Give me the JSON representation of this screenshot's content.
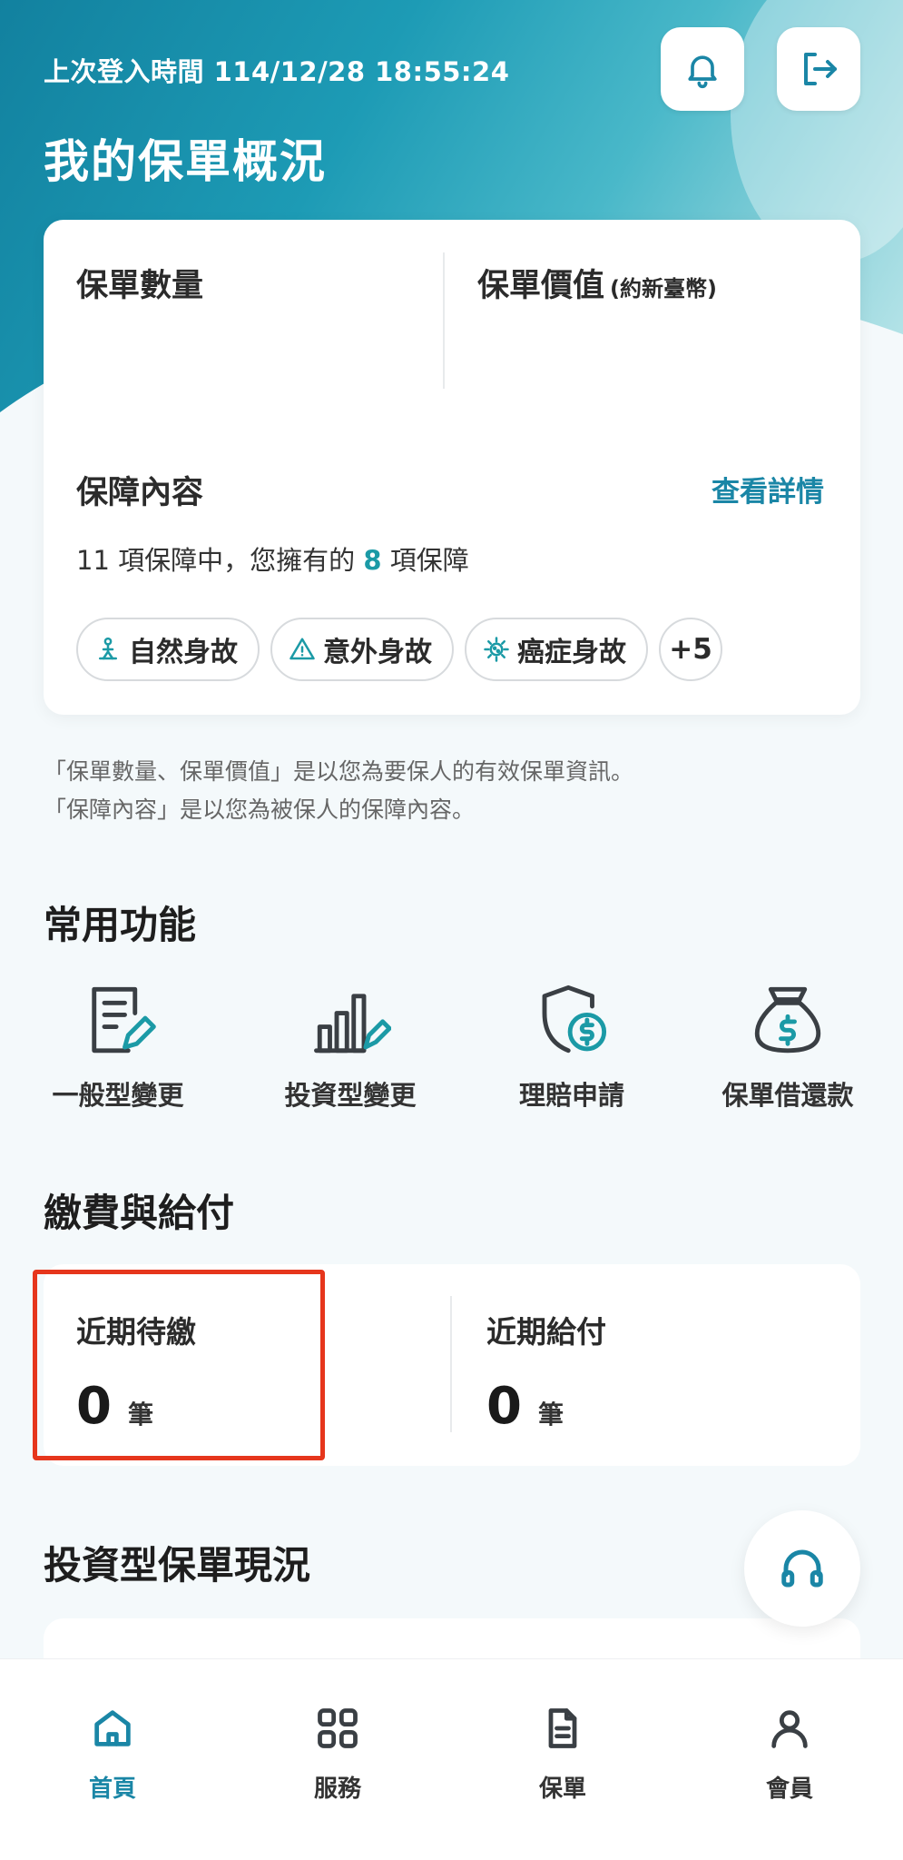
{
  "header": {
    "login_time": "上次登入時間 114/12/28 18:55:24",
    "title": "我的保單概況"
  },
  "overview": {
    "policy_count_label": "保單數量",
    "policy_value_label": "保單價值",
    "policy_value_unit": "(約新臺幣)",
    "coverage_title": "保障內容",
    "coverage_link": "查看詳情",
    "coverage_prefix": "11 項保障中，您擁有的",
    "coverage_owned": "8",
    "coverage_suffix": "項保障",
    "chips": [
      "自然身故",
      "意外身故",
      "癌症身故"
    ],
    "more_chip": "+5"
  },
  "notes": [
    "「保單數量、保單價值」是以您為要保人的有效保單資訊。",
    "「保障內容」是以您為被保人的保障內容。"
  ],
  "common": {
    "title": "常用功能",
    "items": [
      "一般型變更",
      "投資型變更",
      "理賠申請",
      "保單借還款"
    ]
  },
  "payment": {
    "title": "繳費與給付",
    "pending_label": "近期待繳",
    "pending_count": "0",
    "pending_unit": "筆",
    "payout_label": "近期給付",
    "payout_count": "0",
    "payout_unit": "筆"
  },
  "invest": {
    "title": "投資型保單現況"
  },
  "nav": {
    "items": [
      "首頁",
      "服務",
      "保單",
      "會員"
    ]
  },
  "colors": {
    "accent": "#1a86a6",
    "highlight": "#1b9aa6",
    "annotation_box": "#e6361c"
  }
}
